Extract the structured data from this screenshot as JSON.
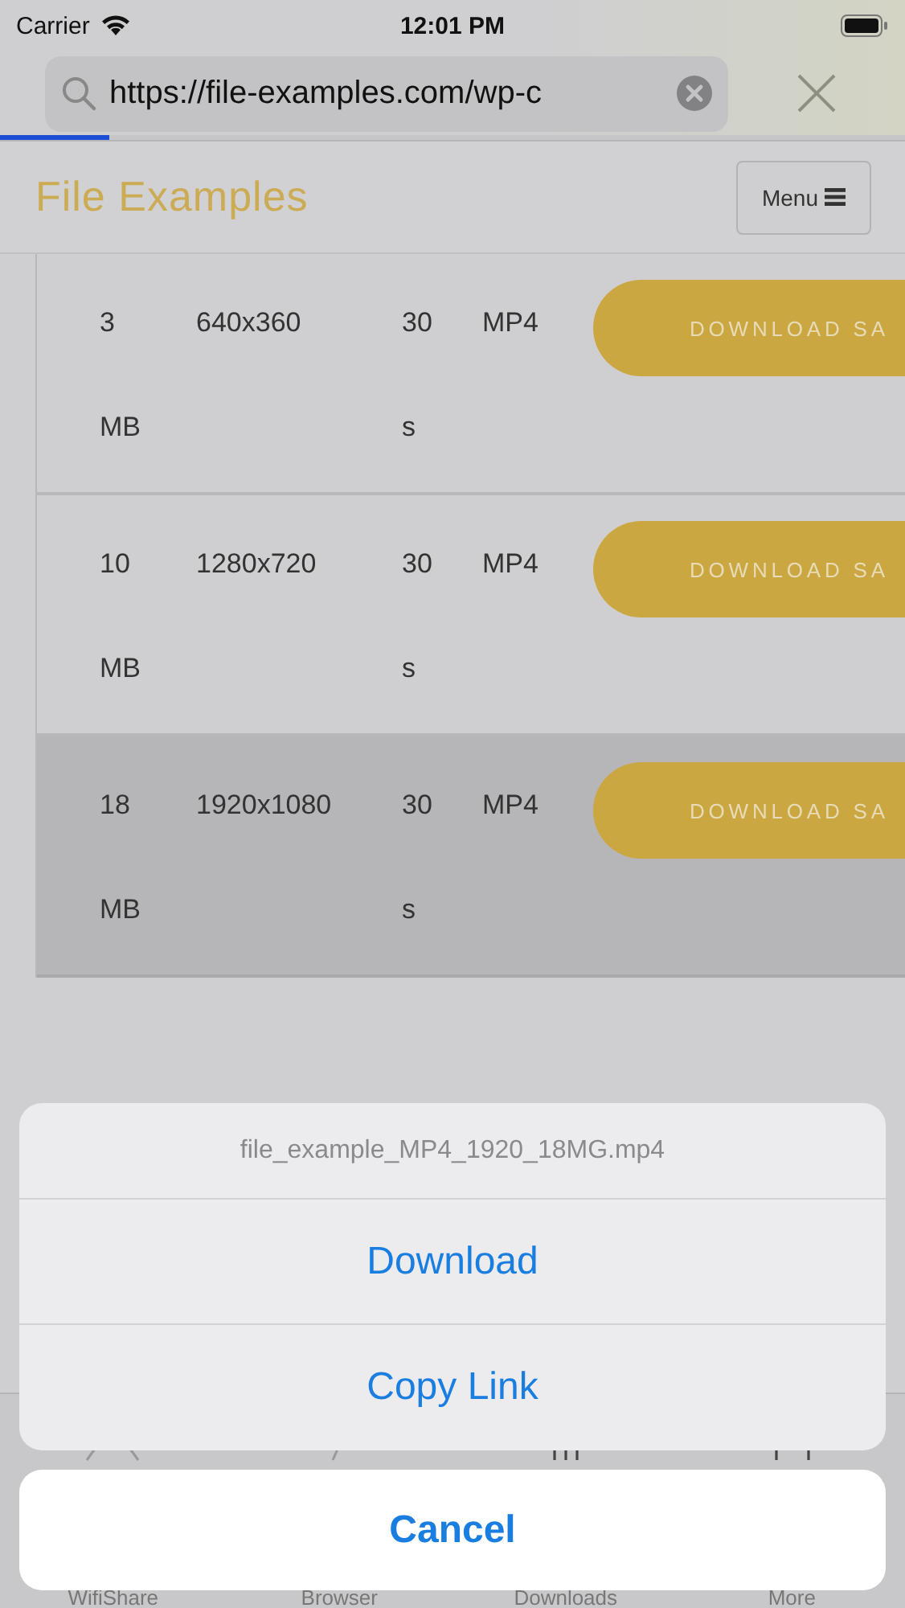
{
  "status_bar": {
    "carrier": "Carrier",
    "time": "12:01 PM"
  },
  "address_bar": {
    "url": "https://file-examples.com/wp-c",
    "progress": {
      "level": 0.12
    }
  },
  "site_header": {
    "title": "File Examples",
    "menu_button": "Menu"
  },
  "table": {
    "rows": [
      {
        "size": "3 MB",
        "resolution": "640x360",
        "duration": "30 s",
        "format": "MP4",
        "button": "DOWNLOAD SA",
        "selected": false
      },
      {
        "size": "10 MB",
        "resolution": "1280x720",
        "duration": "30 s",
        "format": "MP4",
        "button": "DOWNLOAD SA",
        "selected": false
      },
      {
        "size": "18 MB",
        "resolution": "1920x1080",
        "duration": "30 s",
        "format": "MP4",
        "button": "DOWNLOAD SA",
        "selected": true
      }
    ]
  },
  "tab_bar": {
    "items": [
      {
        "label": "WifiShare",
        "kind": "wifi"
      },
      {
        "label": "Browser",
        "kind": "browser"
      },
      {
        "label": "Downloads",
        "kind": "downloads"
      },
      {
        "label": "More",
        "kind": "more"
      }
    ]
  },
  "action_sheet": {
    "title": "file_example_MP4_1920_18MG.mp4",
    "actions": [
      "Download",
      "Copy Link"
    ],
    "cancel": "Cancel"
  }
}
